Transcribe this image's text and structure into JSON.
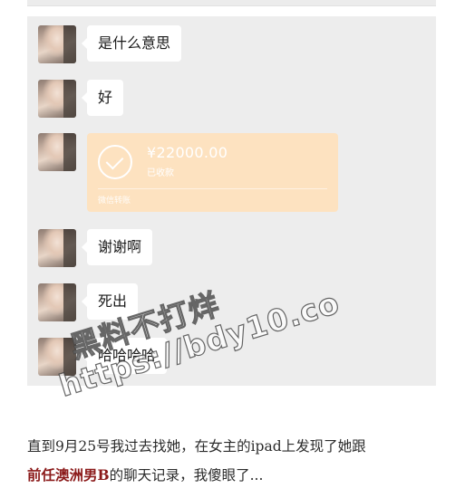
{
  "chat": {
    "messages": [
      {
        "type": "text",
        "text": "是什么意思"
      },
      {
        "type": "text",
        "text": "好"
      },
      {
        "type": "transfer",
        "amount": "¥22000.00",
        "status": "已收款",
        "footer": "微信转账"
      },
      {
        "type": "text",
        "text": "谢谢啊"
      },
      {
        "type": "text",
        "text": "死出"
      },
      {
        "type": "text",
        "text": "哈哈哈哈"
      }
    ]
  },
  "watermark": {
    "line1": "黑料不打烊",
    "line2": "https://bdy10.co"
  },
  "article": {
    "line1": "直到9月25号我过去找她，在女主的ipad上发现了她跟",
    "highlight": "前任澳洲男B",
    "line2_rest": "的聊天记录，我傻眼了..."
  },
  "colors": {
    "chat_bg": "#ededed",
    "transfer_bg": "#fde2c0",
    "highlight": "#8b1a1a"
  }
}
